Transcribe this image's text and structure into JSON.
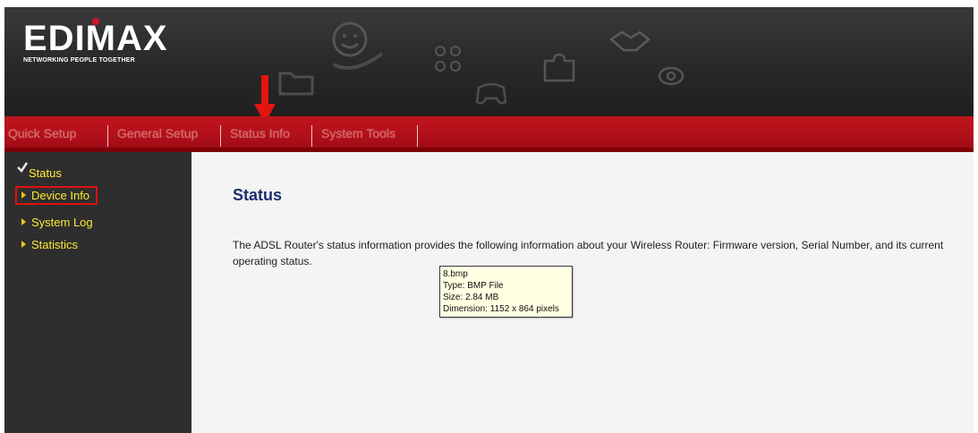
{
  "header": {
    "logo_text": "EDIMAX",
    "logo_tagline": "NETWORKING PEOPLE TOGETHER",
    "decor_icons": [
      "smiley-hand-icon",
      "folder-icon",
      "molecule-icon",
      "gamepad-icon",
      "puzzle-icon",
      "handshake-icon",
      "eye-icon"
    ]
  },
  "nav": {
    "items": [
      {
        "label": "Quick Setup"
      },
      {
        "label": "General Setup"
      },
      {
        "label": "Status Info"
      },
      {
        "label": "System Tools"
      }
    ],
    "highlight_arrow_target": "Status Info"
  },
  "sidebar": {
    "section_title": "Status",
    "items": [
      {
        "label": "Device Info",
        "selected": true
      },
      {
        "label": "System Log",
        "selected": false
      },
      {
        "label": "Statistics",
        "selected": false
      }
    ]
  },
  "main": {
    "title": "Status",
    "description": "The ADSL Router's status information provides the following information about your Wireless Router: Firmware version, Serial Number, and its current operating status."
  },
  "tooltip": {
    "lines": [
      "8.bmp",
      "Type: BMP File",
      "Size: 2.84 MB",
      "Dimension: 1152 x 864 pixels"
    ]
  },
  "colors": {
    "nav_red": "#b1101a",
    "sidebar_bg": "#2e2e2e",
    "sidebar_text": "#ffe834",
    "title_navy": "#1c2d6e",
    "highlight_red": "#e01010"
  }
}
